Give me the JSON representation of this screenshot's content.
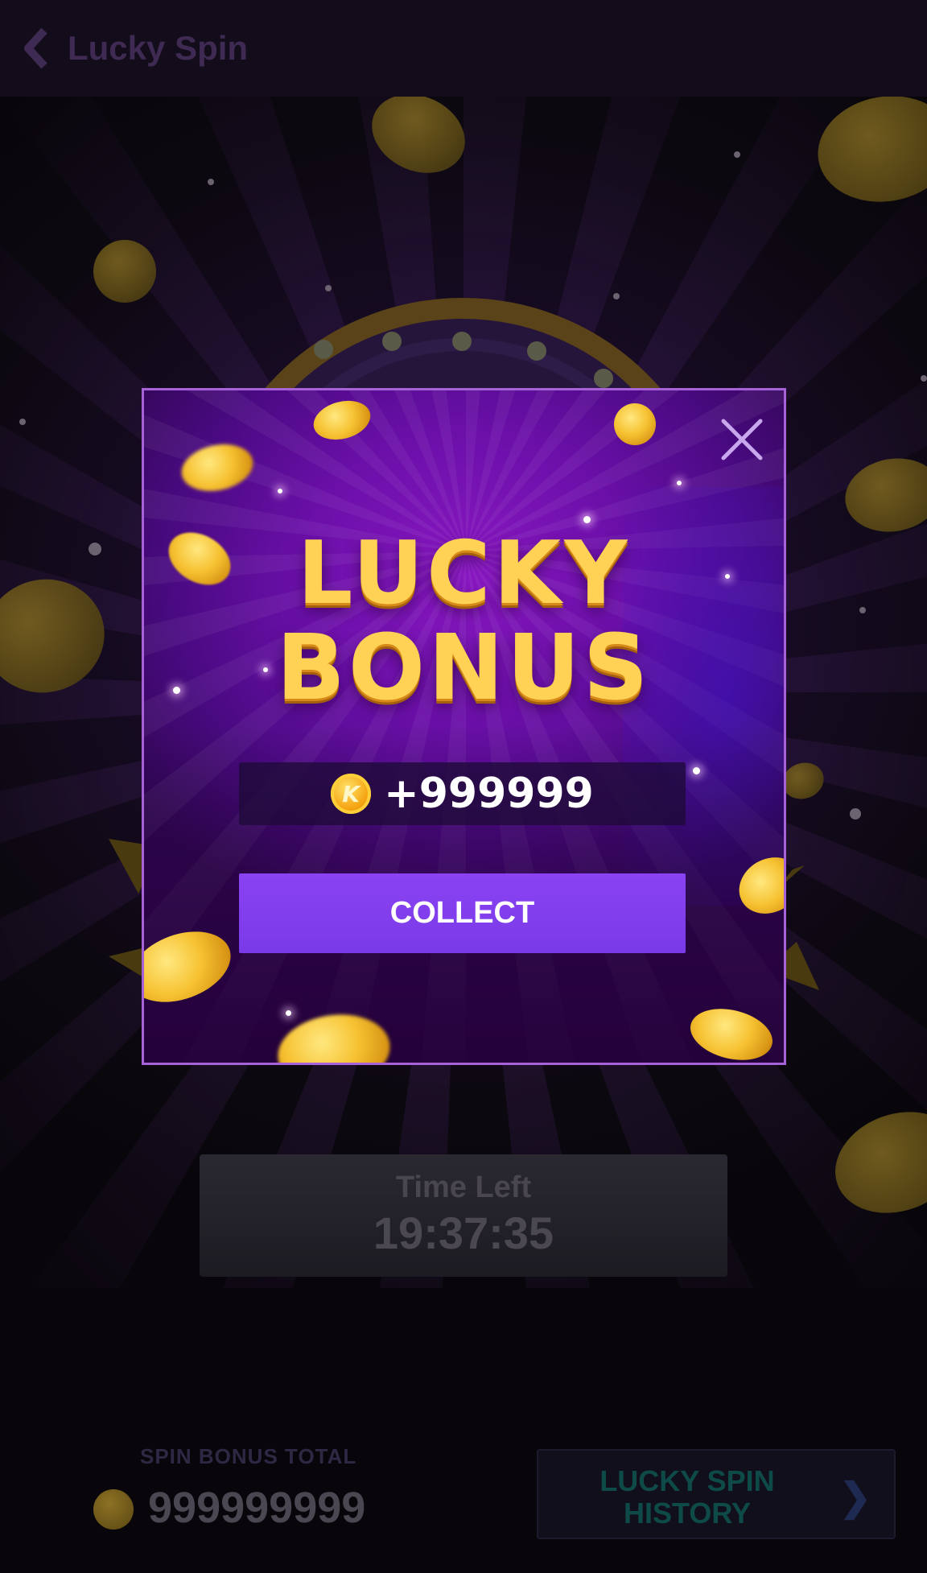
{
  "header": {
    "title": "Lucky Spin",
    "back_icon": "chevron-left-icon"
  },
  "timer": {
    "label": "Time Left",
    "value": "19:37:35"
  },
  "footer": {
    "bonus_total_label": "SPIN BONUS TOTAL",
    "bonus_total_value": "999999999",
    "history_button_label": "LUCKY SPIN HISTORY",
    "history_chevron": "❯"
  },
  "modal": {
    "headline_line1": "LUCKY",
    "headline_line2": "BONUS",
    "reward_coin_letter": "K",
    "reward_value": "+999999",
    "collect_label": "COLLECT",
    "close_icon": "close-icon"
  },
  "colors": {
    "modal_border": "#a762d8",
    "collect_button": "#7a3ae8",
    "headline_gold": "#ffd256",
    "history_text": "#0d4a48"
  }
}
